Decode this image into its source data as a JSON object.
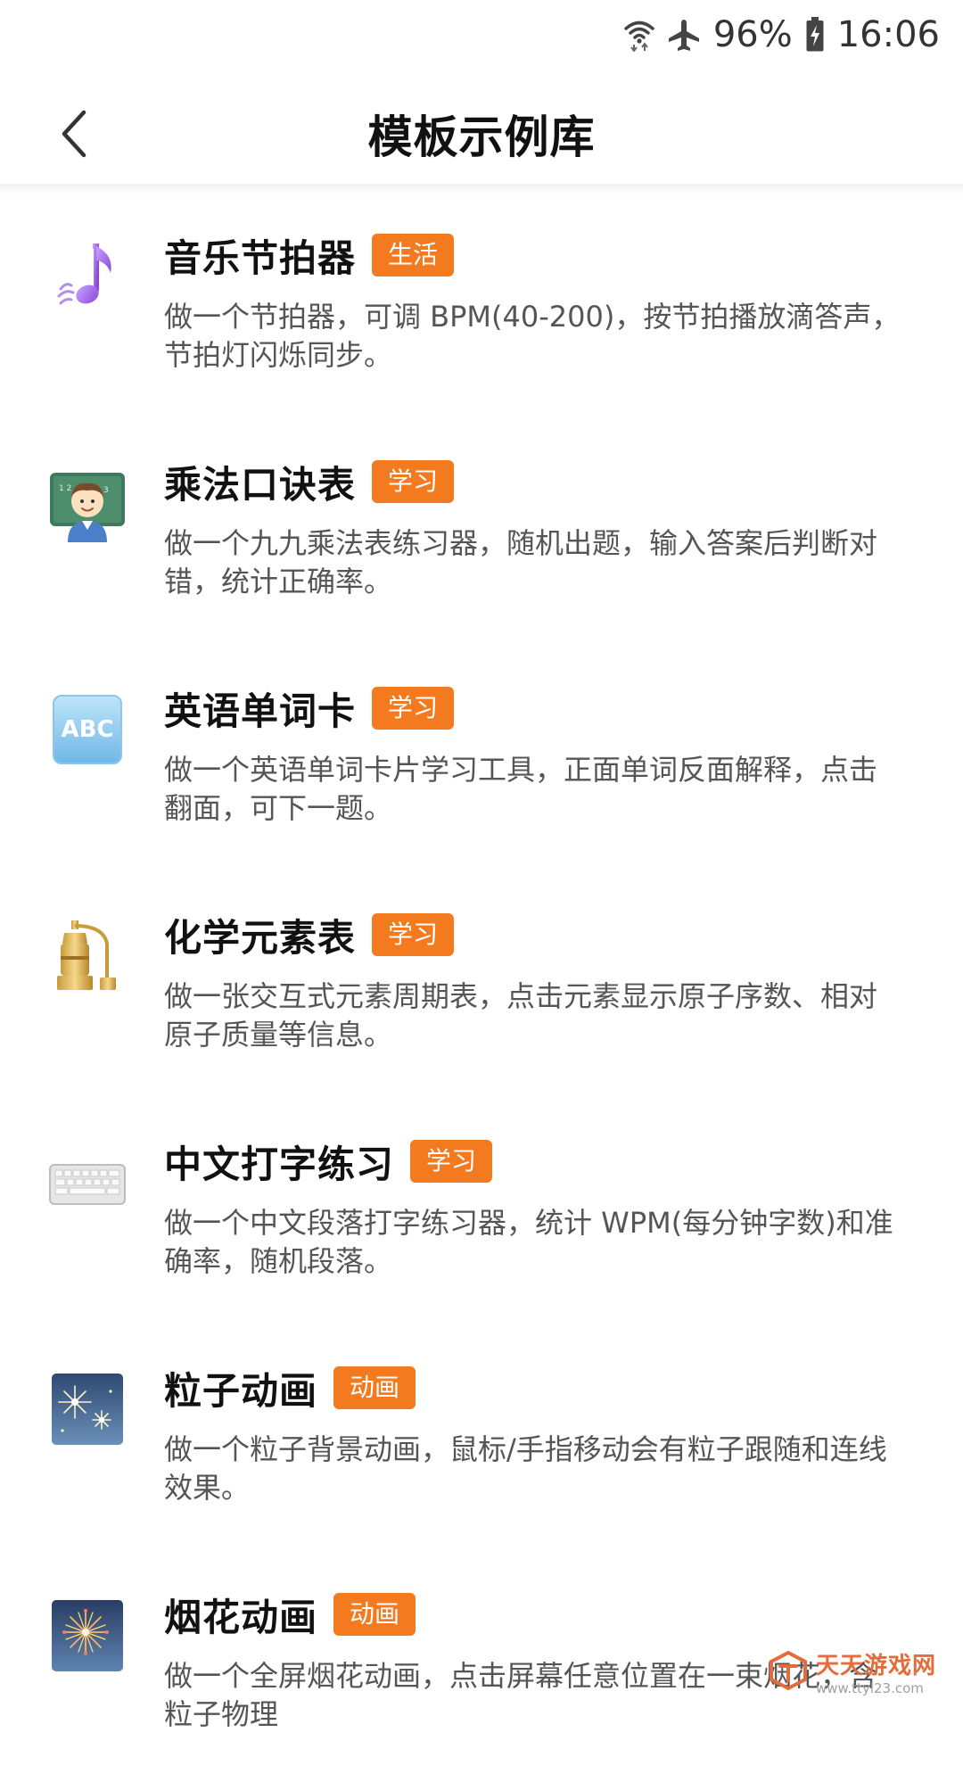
{
  "status_bar": {
    "battery": "96%",
    "time": "16:06"
  },
  "header": {
    "title": "模板示例库"
  },
  "templates": [
    {
      "title": "音乐节拍器",
      "tag": "生活",
      "icon": "music-note-icon",
      "description": "做一个节拍器，可调 BPM(40-200)，按节拍播放滴答声，节拍灯闪烁同步。"
    },
    {
      "title": "乘法口诀表",
      "tag": "学习",
      "icon": "teacher-icon",
      "description": "做一个九九乘法表练习器，随机出题，输入答案后判断对错，统计正确率。"
    },
    {
      "title": "英语单词卡",
      "tag": "学习",
      "icon": "abc-icon",
      "description": "做一个英语单词卡片学习工具，正面单词反面解释，点击翻面，可下一题。"
    },
    {
      "title": "化学元素表",
      "tag": "学习",
      "icon": "alembic-icon",
      "description": "做一张交互式元素周期表，点击元素显示原子序数、相对原子质量等信息。"
    },
    {
      "title": "中文打字练习",
      "tag": "学习",
      "icon": "keyboard-icon",
      "description": "做一个中文段落打字练习器，统计 WPM(每分钟字数)和准确率，随机段落。"
    },
    {
      "title": "粒子动画",
      "tag": "动画",
      "icon": "sparkler-icon",
      "description": "做一个粒子背景动画，鼠标/手指移动会有粒子跟随和连线效果。"
    },
    {
      "title": "烟花动画",
      "tag": "动画",
      "icon": "fireworks-icon",
      "description": "做一个全屏烟花动画，点击屏幕任意位置在一束烟花，含粒子物理"
    }
  ],
  "watermark": {
    "title": "天天游戏网",
    "url": "www.ttyl23.com"
  },
  "colors": {
    "tag_bg": "#f47a1f",
    "title_text": "#111111",
    "desc_text": "#555555"
  }
}
